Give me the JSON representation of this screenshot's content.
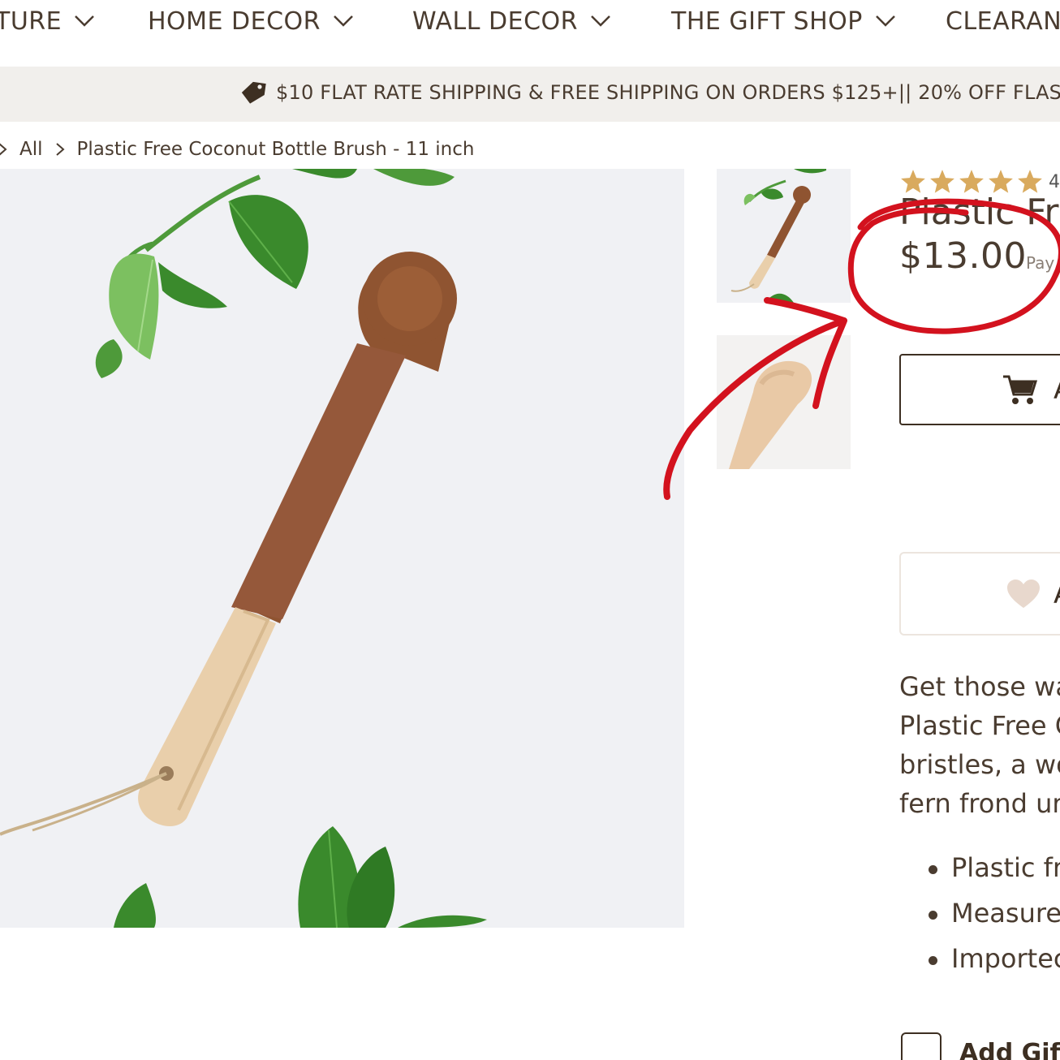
{
  "nav": {
    "items": [
      {
        "label": "TURE"
      },
      {
        "label": "HOME DECOR"
      },
      {
        "label": "WALL DECOR"
      },
      {
        "label": "THE GIFT SHOP"
      },
      {
        "label": "CLEARAN"
      }
    ]
  },
  "banner": {
    "text": "$10 FLAT RATE SHIPPING & FREE SHIPPING ON ORDERS $125+|| 20% OFF FLAS"
  },
  "breadcrumb": {
    "items": [
      "All",
      "Plastic Free Coconut Bottle Brush - 11 inch"
    ]
  },
  "product": {
    "rating_count": "4",
    "title": "Plastic Fr",
    "price": "$13.00",
    "pay_label": "Pay",
    "add_to_cart_label": "A",
    "wishlist_label": "A",
    "description_lines": [
      "Get those wa",
      "Plastic Free C",
      "bristles, a wo",
      "fern frond ur"
    ],
    "features": [
      "Plastic fr",
      "Measure",
      "Importec"
    ],
    "gift_label": "Add Gift"
  },
  "colors": {
    "text": "#4a3c30",
    "star": "#d9aa5e",
    "banner_bg": "#f1efec",
    "annotation": "#d3121e"
  }
}
